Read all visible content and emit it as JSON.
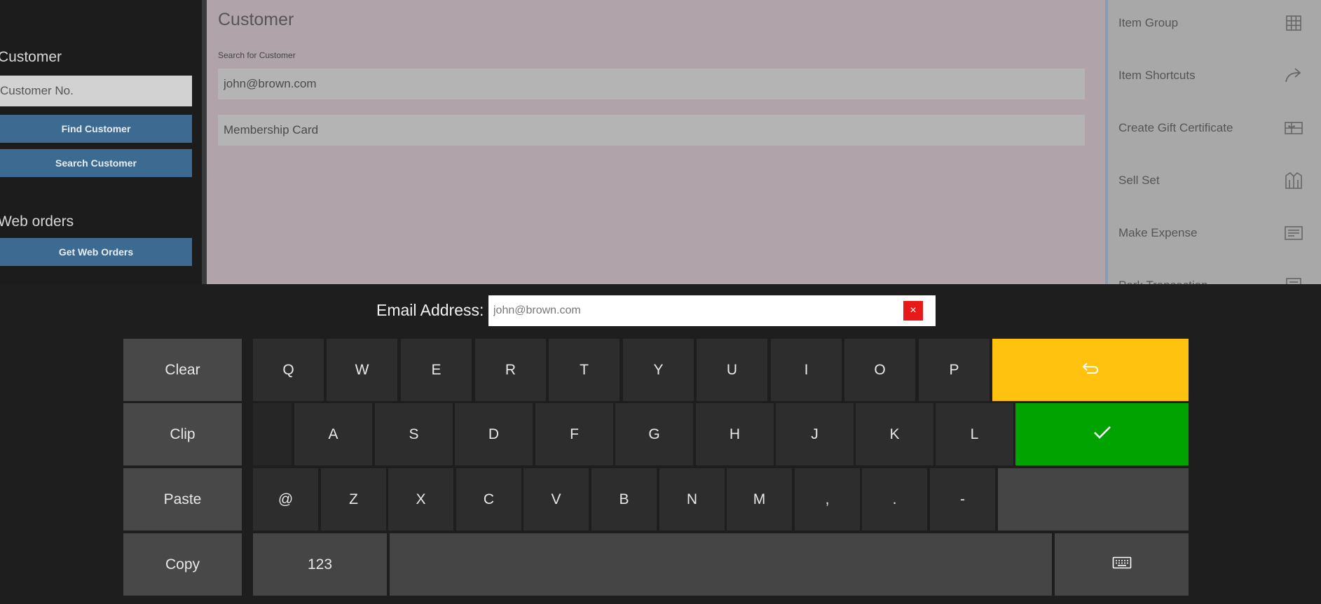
{
  "left": {
    "customer_heading": "Customer",
    "customer_no_placeholder": "Customer No.",
    "find_customer": "Find Customer",
    "search_customer": "Search Customer",
    "web_orders_heading": "Web orders",
    "get_web_orders": "Get Web Orders"
  },
  "main": {
    "title": "Customer",
    "search_label": "Search for Customer",
    "email_value": "john@brown.com",
    "membership_placeholder": "Membership Card"
  },
  "right": {
    "items": [
      {
        "label": "Item Group",
        "icon": "grid-icon"
      },
      {
        "label": "Item Shortcuts",
        "icon": "share-arrow-icon"
      },
      {
        "label": "Create Gift Certificate",
        "icon": "gift-card-icon"
      },
      {
        "label": "Sell Set",
        "icon": "jacket-icon"
      },
      {
        "label": "Make Expense",
        "icon": "receipt-icon"
      },
      {
        "label": "Park Transaction",
        "icon": "list-icon"
      }
    ]
  },
  "keyboard": {
    "field_label": "Email Address:",
    "field_value": "john@brown.com",
    "clear_symbol": "×",
    "side_keys": [
      "Clear",
      "Clip",
      "Paste",
      "Copy"
    ],
    "row1": [
      "Q",
      "W",
      "E",
      "R",
      "T",
      "Y",
      "U",
      "I",
      "O",
      "P"
    ],
    "row2": [
      "A",
      "S",
      "D",
      "F",
      "G",
      "H",
      "J",
      "K",
      "L"
    ],
    "row3": [
      "@",
      "Z",
      "X",
      "C",
      "V",
      "B",
      "N",
      "M",
      ",",
      ".",
      "-"
    ],
    "numbers_key": "123",
    "colors": {
      "backspace": "#ffc30f",
      "enter": "#00a300",
      "clear_x": "#e81919"
    }
  }
}
